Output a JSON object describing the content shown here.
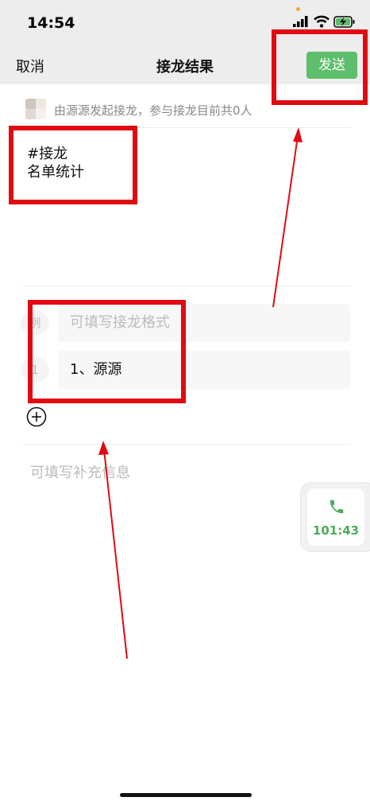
{
  "status": {
    "time": "14:54",
    "accent_dot_color": "#f3a13a",
    "icons": [
      "cellular-signal-icon",
      "wifi-icon",
      "battery-charging-icon"
    ]
  },
  "nav": {
    "cancel_label": "取消",
    "title": "接龙结果",
    "send_label": "发送"
  },
  "initiator": {
    "text": "由源源发起接龙，参与接龙目前共0人"
  },
  "body": {
    "title_line1": "#接龙",
    "title_line2": "名单统计"
  },
  "entries": {
    "example_label": "例",
    "example_placeholder": "可填写接龙格式",
    "items": [
      {
        "number": "1",
        "value": "1、源源"
      }
    ],
    "add_icon": "plus-circle-icon"
  },
  "supplement": {
    "placeholder": "可填写补充信息"
  },
  "call": {
    "duration": "101:43",
    "icon": "phone-icon",
    "color": "#4cac5b"
  },
  "colors": {
    "send_button": "#5dbe6b",
    "annotation_red": "#e00a12",
    "nav_background": "#ededed"
  }
}
